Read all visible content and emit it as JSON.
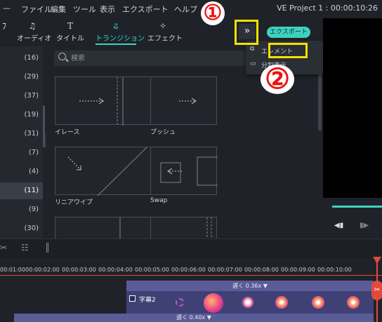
{
  "menubar": {
    "items": [
      "ファイル",
      "編集",
      "ツール",
      "表示",
      "エクスポート",
      "ヘルプ"
    ],
    "project_title": "VE Project 1 : 00:00:10:26"
  },
  "toolbar": {
    "tabs": [
      {
        "label": "オーディオ",
        "icon": "music-note-icon"
      },
      {
        "label": "タイトル",
        "icon": "text-T-icon"
      },
      {
        "label": "トランジション",
        "icon": "transition-icon"
      },
      {
        "label": "エフェクト",
        "icon": "sparkle-icon"
      }
    ],
    "active_tab": "トランジション",
    "more_button": "»",
    "export_label": "エクスポート"
  },
  "dropdown": {
    "items": [
      "エレメント",
      "分割表示"
    ]
  },
  "categories": [
    "(16)",
    "(29)",
    "(37)",
    "(19)",
    "(31)",
    "(7)",
    "(4)",
    "(11)",
    "(9)",
    "(30)"
  ],
  "selected_category": "(11)",
  "search": {
    "placeholder": "検索"
  },
  "transitions": [
    {
      "label": "イレース"
    },
    {
      "label": "プッシュ"
    },
    {
      "label": "リニアワイプ"
    },
    {
      "label": "Swap"
    }
  ],
  "timeline": {
    "ticks": [
      "00:01:00",
      "00:00:02:00",
      "00:00:03:00",
      "00:00:04:00",
      "00:00:05:00",
      "00:00:06:00",
      "00:00:07:00",
      "00:00:08:00",
      "00:00:09:00",
      "00:00:10:00"
    ],
    "track1_header": "遅く 0.36x ▼",
    "track1_label": "字幕2",
    "track2_header": "遅く 0.40x ▼"
  },
  "annotations": {
    "step1": "①",
    "step2": "②"
  },
  "colors": {
    "accent": "#3fd1c0",
    "highlight": "#f2e200",
    "annotation_red": "#e11111",
    "playhead": "#e24a3b",
    "track": "#5a5c98"
  }
}
